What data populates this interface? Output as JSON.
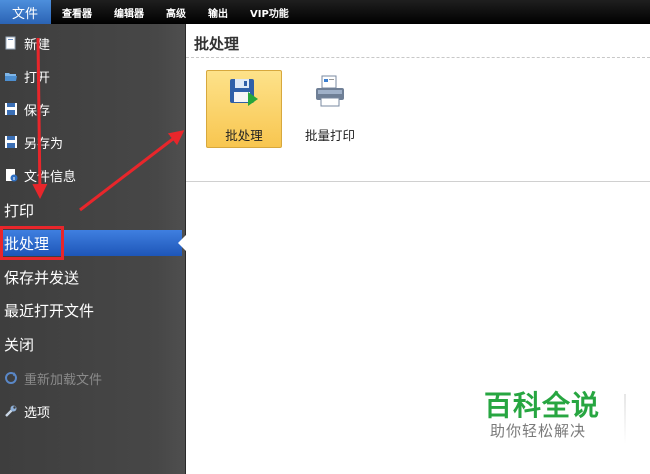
{
  "menubar": {
    "items": [
      {
        "label": "文件",
        "active": true
      },
      {
        "label": "查看器"
      },
      {
        "label": "编辑器"
      },
      {
        "label": "高级"
      },
      {
        "label": "输出"
      },
      {
        "label": "VIP功能"
      }
    ]
  },
  "sidebar": {
    "items": [
      {
        "label": "新建",
        "icon": "new-file-icon"
      },
      {
        "label": "打开",
        "icon": "folder-open-icon"
      },
      {
        "label": "保存",
        "icon": "floppy-save-icon"
      },
      {
        "label": "另存为",
        "icon": "floppy-save-as-icon"
      },
      {
        "label": "文件信息",
        "icon": "file-info-icon"
      },
      {
        "label": "打印"
      },
      {
        "label": "批处理",
        "selected": true
      },
      {
        "label": "保存并发送"
      },
      {
        "label": "最近打开文件"
      },
      {
        "label": "关闭"
      },
      {
        "label": "重新加载文件",
        "icon": "reload-icon",
        "disabled": true
      },
      {
        "label": "选项",
        "icon": "wrench-icon"
      }
    ]
  },
  "main": {
    "title": "批处理",
    "tools": [
      {
        "label": "批处理",
        "icon": "batch-save-icon",
        "active": true
      },
      {
        "label": "批量打印",
        "icon": "batch-print-icon"
      }
    ]
  },
  "watermark": {
    "title": "百科全说",
    "subtitle": "助你轻松解决"
  },
  "colors": {
    "accent": "#2b63b4",
    "selection": "#1e56b8",
    "annotation": "#e8262b",
    "watermark": "#27a641"
  }
}
